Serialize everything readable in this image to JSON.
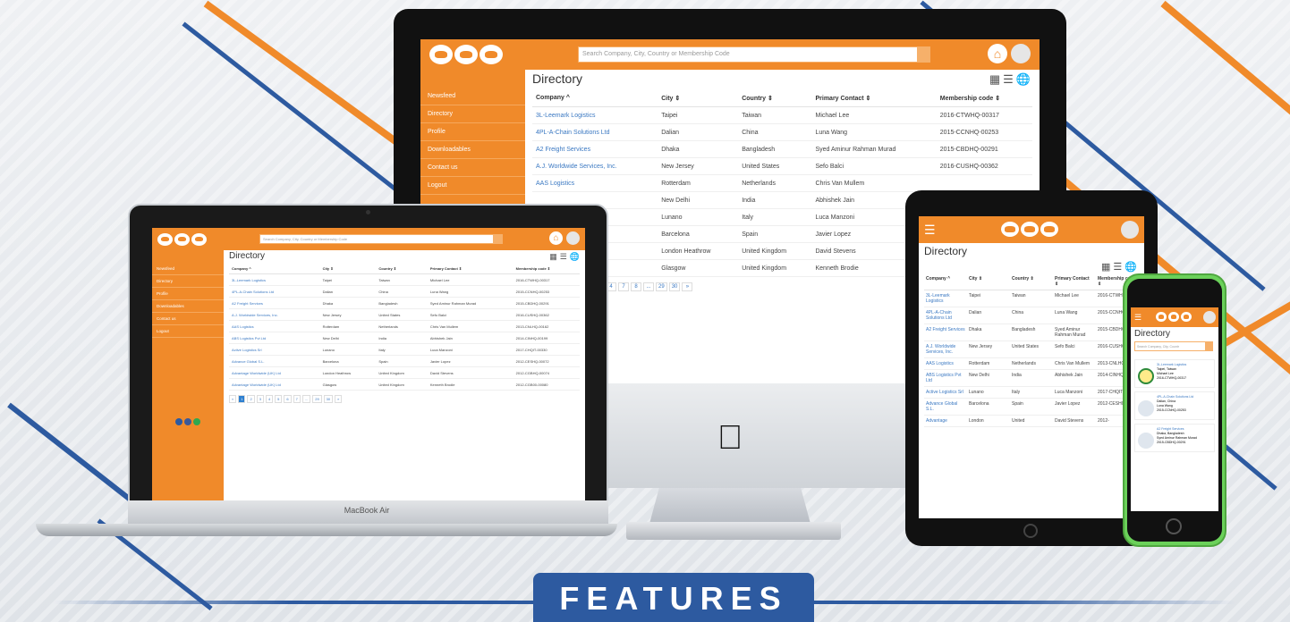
{
  "colors": {
    "accent": "#f08a2a",
    "link": "#3a78c2",
    "banner": "#2d5aa0",
    "iphone": "#6bd15a"
  },
  "search_placeholder": "Search Company, City, Country or Membership Code",
  "sidebar": [
    "Newsfeed",
    "Directory",
    "Profile",
    "Downloadables",
    "Contact us",
    "Logout"
  ],
  "directory_title": "Directory",
  "columns": [
    "Company ^",
    "City ⇕",
    "Country ⇕",
    "Primary Contact ⇕",
    "Membership code ⇕"
  ],
  "imac_rows": [
    [
      "3L-Leemark Logistics",
      "Taipei",
      "Taiwan",
      "Michael Lee",
      "2016-CTWHQ-00317"
    ],
    [
      "4PL-A-Chain Solutions Ltd",
      "Dalian",
      "China",
      "Luna Wang",
      "2015-CCNHQ-00253"
    ],
    [
      "A2 Freight Services",
      "Dhaka",
      "Bangladesh",
      "Syed Aminur Rahman Murad",
      "2015-CBDHQ-00291"
    ],
    [
      "A.J. Worldwide Services, Inc.",
      "New Jersey",
      "United States",
      "Sefo Balci",
      "2016-CUSHQ-00362"
    ],
    [
      "AAS Logistics",
      "Rotterdam",
      "Netherlands",
      "Chris Van Mullem",
      ""
    ],
    [
      "",
      "New Delhi",
      "India",
      "Abhishek Jain",
      ""
    ],
    [
      "",
      "Lunano",
      "Italy",
      "Luca Manzoni",
      ""
    ],
    [
      "",
      "Barcelona",
      "Spain",
      "Javier Lopez",
      ""
    ],
    [
      "Ltd",
      "London Heathrow",
      "United Kingdom",
      "David Stevens",
      ""
    ],
    [
      "Ltd",
      "Glasgow",
      "United Kingdom",
      "Kenneth Brodie",
      ""
    ]
  ],
  "imac_pager": [
    "4",
    "7",
    "8",
    "...",
    "29",
    "30",
    "»"
  ],
  "macbook_rows": [
    [
      "3L-Leemark Logistics",
      "Taipei",
      "Taiwan",
      "Michael Lee",
      "2016-CTWHQ-00317"
    ],
    [
      "4PL-A-Chain Solutions Ltd",
      "Dalian",
      "China",
      "Luna Wang",
      "2015-CCNHQ-00253"
    ],
    [
      "A2 Freight Services",
      "Dhaka",
      "Bangladesh",
      "Syed Aminur Rahman Murad",
      "2015-CBDHQ-00291"
    ],
    [
      "A.J. Worldwide Services, Inc.",
      "New Jersey",
      "United States",
      "Sefo Balci",
      "2016-CUSHQ-00362"
    ],
    [
      "AAS Logistics",
      "Rotterdam",
      "Netherlands",
      "Chris Van Mullem",
      "2013-CNLHQ-00162"
    ],
    [
      "ABS Logistics Pvt Ltd",
      "New Delhi",
      "India",
      "Abhishek Jain",
      "2014-CINHQ-00199"
    ],
    [
      "Active Logistics Srl",
      "Lunano",
      "Italy",
      "Luca Manzoni",
      "2017-CHQIT-00330"
    ],
    [
      "Advance Global S.L.",
      "Barcelona",
      "Spain",
      "Javier Lopez",
      "2012-CESHQ-00072"
    ],
    [
      "Advantage Worldwide (UK) Ltd",
      "London Heathrow",
      "United Kingdom",
      "David Stevens",
      "2012-CGBHQ-00074"
    ],
    [
      "Advantage Worldwide (UK) Ltd",
      "Glasgow",
      "United Kingdom",
      "Kenneth Brodie",
      "2012-CGB00-00080"
    ]
  ],
  "macbook_pager": [
    "«",
    "1",
    "2",
    "3",
    "4",
    "5",
    "6",
    "7",
    "...",
    "29",
    "30",
    "»"
  ],
  "ipad_columns": [
    "Company ^",
    "City ⇕",
    "Country ⇕",
    "Primary Contact ⇕",
    "Membership code ⇕"
  ],
  "ipad_rows": [
    [
      "3L-Leemark Logistics",
      "Taipei",
      "Taiwan",
      "Michael Lee",
      "2016-CTWHQ-0"
    ],
    [
      "4PL-A-Chain Solutions Ltd",
      "Dalian",
      "China",
      "Luna Wang",
      "2015-CCNHQ-0"
    ],
    [
      "A2 Freight Services",
      "Dhaka",
      "Bangladesh",
      "Syed Aminur Rahman Murad",
      "2015-CBDHQ-0"
    ],
    [
      "A.J. Worldwide Services, Inc.",
      "New Jersey",
      "United States",
      "Sefo Balci",
      "2016-CUSHQ-0"
    ],
    [
      "AAS Logistics",
      "Rotterdam",
      "Netherlands",
      "Chris Van Mullem",
      "2013-CNLHQ-0"
    ],
    [
      "ABS Logistics Pvt Ltd",
      "New Delhi",
      "India",
      "Abhishek Jain",
      "2014-CINHQ-0"
    ],
    [
      "Active Logistics Srl",
      "Lunano",
      "Italy",
      "Luca Manzoni",
      "2017-CHQIT-00"
    ],
    [
      "Advance Global S.L.",
      "Barcelona",
      "Spain",
      "Javier Lopez",
      "2012-CESHQ-0"
    ],
    [
      "Advantage",
      "London",
      "United",
      "David Stevens",
      "2012-"
    ]
  ],
  "iphone_search_placeholder": "Search Company, City, Countr",
  "iphone_cards": [
    {
      "company": "3L-Leemark Logistics",
      "contact": "Taipei, Taiwan",
      "person": "Michael Lee",
      "code": "2016-CTWHQ-00317"
    },
    {
      "company": "4PL-A-Chain Solutions Ltd",
      "contact": "Dalian, China",
      "person": "Luna Wang",
      "code": "2015-CCNHQ-00253"
    },
    {
      "company": "A2 Freight Services",
      "contact": "Dhaka, Bangladesh",
      "person": "Syed Aminur Rahman Murad",
      "code": "2015-CBDHQ-00291"
    }
  ],
  "device_label": "MacBook Air",
  "banner": "FEATURES"
}
